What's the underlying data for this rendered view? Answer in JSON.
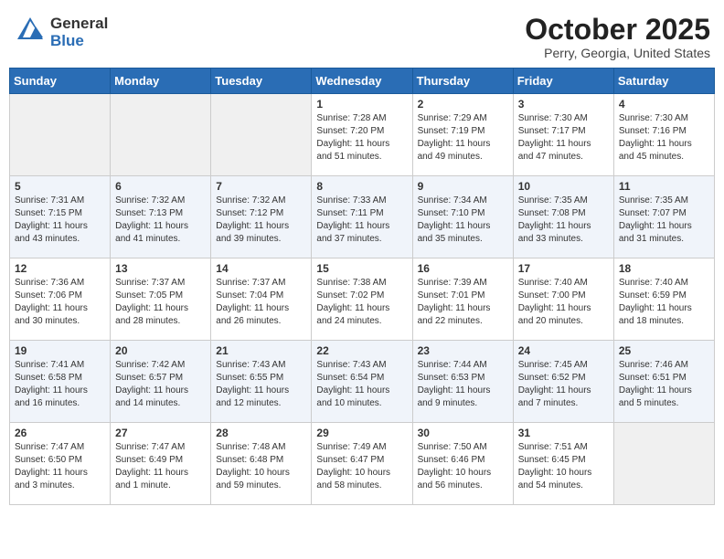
{
  "header": {
    "logo_general": "General",
    "logo_blue": "Blue",
    "month_title": "October 2025",
    "location": "Perry, Georgia, United States"
  },
  "days_of_week": [
    "Sunday",
    "Monday",
    "Tuesday",
    "Wednesday",
    "Thursday",
    "Friday",
    "Saturday"
  ],
  "weeks": [
    [
      {
        "num": "",
        "sunrise": "",
        "sunset": "",
        "daylight": "",
        "empty": true
      },
      {
        "num": "",
        "sunrise": "",
        "sunset": "",
        "daylight": "",
        "empty": true
      },
      {
        "num": "",
        "sunrise": "",
        "sunset": "",
        "daylight": "",
        "empty": true
      },
      {
        "num": "1",
        "sunrise": "Sunrise: 7:28 AM",
        "sunset": "Sunset: 7:20 PM",
        "daylight": "Daylight: 11 hours and 51 minutes.",
        "empty": false
      },
      {
        "num": "2",
        "sunrise": "Sunrise: 7:29 AM",
        "sunset": "Sunset: 7:19 PM",
        "daylight": "Daylight: 11 hours and 49 minutes.",
        "empty": false
      },
      {
        "num": "3",
        "sunrise": "Sunrise: 7:30 AM",
        "sunset": "Sunset: 7:17 PM",
        "daylight": "Daylight: 11 hours and 47 minutes.",
        "empty": false
      },
      {
        "num": "4",
        "sunrise": "Sunrise: 7:30 AM",
        "sunset": "Sunset: 7:16 PM",
        "daylight": "Daylight: 11 hours and 45 minutes.",
        "empty": false
      }
    ],
    [
      {
        "num": "5",
        "sunrise": "Sunrise: 7:31 AM",
        "sunset": "Sunset: 7:15 PM",
        "daylight": "Daylight: 11 hours and 43 minutes.",
        "empty": false
      },
      {
        "num": "6",
        "sunrise": "Sunrise: 7:32 AM",
        "sunset": "Sunset: 7:13 PM",
        "daylight": "Daylight: 11 hours and 41 minutes.",
        "empty": false
      },
      {
        "num": "7",
        "sunrise": "Sunrise: 7:32 AM",
        "sunset": "Sunset: 7:12 PM",
        "daylight": "Daylight: 11 hours and 39 minutes.",
        "empty": false
      },
      {
        "num": "8",
        "sunrise": "Sunrise: 7:33 AM",
        "sunset": "Sunset: 7:11 PM",
        "daylight": "Daylight: 11 hours and 37 minutes.",
        "empty": false
      },
      {
        "num": "9",
        "sunrise": "Sunrise: 7:34 AM",
        "sunset": "Sunset: 7:10 PM",
        "daylight": "Daylight: 11 hours and 35 minutes.",
        "empty": false
      },
      {
        "num": "10",
        "sunrise": "Sunrise: 7:35 AM",
        "sunset": "Sunset: 7:08 PM",
        "daylight": "Daylight: 11 hours and 33 minutes.",
        "empty": false
      },
      {
        "num": "11",
        "sunrise": "Sunrise: 7:35 AM",
        "sunset": "Sunset: 7:07 PM",
        "daylight": "Daylight: 11 hours and 31 minutes.",
        "empty": false
      }
    ],
    [
      {
        "num": "12",
        "sunrise": "Sunrise: 7:36 AM",
        "sunset": "Sunset: 7:06 PM",
        "daylight": "Daylight: 11 hours and 30 minutes.",
        "empty": false
      },
      {
        "num": "13",
        "sunrise": "Sunrise: 7:37 AM",
        "sunset": "Sunset: 7:05 PM",
        "daylight": "Daylight: 11 hours and 28 minutes.",
        "empty": false
      },
      {
        "num": "14",
        "sunrise": "Sunrise: 7:37 AM",
        "sunset": "Sunset: 7:04 PM",
        "daylight": "Daylight: 11 hours and 26 minutes.",
        "empty": false
      },
      {
        "num": "15",
        "sunrise": "Sunrise: 7:38 AM",
        "sunset": "Sunset: 7:02 PM",
        "daylight": "Daylight: 11 hours and 24 minutes.",
        "empty": false
      },
      {
        "num": "16",
        "sunrise": "Sunrise: 7:39 AM",
        "sunset": "Sunset: 7:01 PM",
        "daylight": "Daylight: 11 hours and 22 minutes.",
        "empty": false
      },
      {
        "num": "17",
        "sunrise": "Sunrise: 7:40 AM",
        "sunset": "Sunset: 7:00 PM",
        "daylight": "Daylight: 11 hours and 20 minutes.",
        "empty": false
      },
      {
        "num": "18",
        "sunrise": "Sunrise: 7:40 AM",
        "sunset": "Sunset: 6:59 PM",
        "daylight": "Daylight: 11 hours and 18 minutes.",
        "empty": false
      }
    ],
    [
      {
        "num": "19",
        "sunrise": "Sunrise: 7:41 AM",
        "sunset": "Sunset: 6:58 PM",
        "daylight": "Daylight: 11 hours and 16 minutes.",
        "empty": false
      },
      {
        "num": "20",
        "sunrise": "Sunrise: 7:42 AM",
        "sunset": "Sunset: 6:57 PM",
        "daylight": "Daylight: 11 hours and 14 minutes.",
        "empty": false
      },
      {
        "num": "21",
        "sunrise": "Sunrise: 7:43 AM",
        "sunset": "Sunset: 6:55 PM",
        "daylight": "Daylight: 11 hours and 12 minutes.",
        "empty": false
      },
      {
        "num": "22",
        "sunrise": "Sunrise: 7:43 AM",
        "sunset": "Sunset: 6:54 PM",
        "daylight": "Daylight: 11 hours and 10 minutes.",
        "empty": false
      },
      {
        "num": "23",
        "sunrise": "Sunrise: 7:44 AM",
        "sunset": "Sunset: 6:53 PM",
        "daylight": "Daylight: 11 hours and 9 minutes.",
        "empty": false
      },
      {
        "num": "24",
        "sunrise": "Sunrise: 7:45 AM",
        "sunset": "Sunset: 6:52 PM",
        "daylight": "Daylight: 11 hours and 7 minutes.",
        "empty": false
      },
      {
        "num": "25",
        "sunrise": "Sunrise: 7:46 AM",
        "sunset": "Sunset: 6:51 PM",
        "daylight": "Daylight: 11 hours and 5 minutes.",
        "empty": false
      }
    ],
    [
      {
        "num": "26",
        "sunrise": "Sunrise: 7:47 AM",
        "sunset": "Sunset: 6:50 PM",
        "daylight": "Daylight: 11 hours and 3 minutes.",
        "empty": false
      },
      {
        "num": "27",
        "sunrise": "Sunrise: 7:47 AM",
        "sunset": "Sunset: 6:49 PM",
        "daylight": "Daylight: 11 hours and 1 minute.",
        "empty": false
      },
      {
        "num": "28",
        "sunrise": "Sunrise: 7:48 AM",
        "sunset": "Sunset: 6:48 PM",
        "daylight": "Daylight: 10 hours and 59 minutes.",
        "empty": false
      },
      {
        "num": "29",
        "sunrise": "Sunrise: 7:49 AM",
        "sunset": "Sunset: 6:47 PM",
        "daylight": "Daylight: 10 hours and 58 minutes.",
        "empty": false
      },
      {
        "num": "30",
        "sunrise": "Sunrise: 7:50 AM",
        "sunset": "Sunset: 6:46 PM",
        "daylight": "Daylight: 10 hours and 56 minutes.",
        "empty": false
      },
      {
        "num": "31",
        "sunrise": "Sunrise: 7:51 AM",
        "sunset": "Sunset: 6:45 PM",
        "daylight": "Daylight: 10 hours and 54 minutes.",
        "empty": false
      },
      {
        "num": "",
        "sunrise": "",
        "sunset": "",
        "daylight": "",
        "empty": true
      }
    ]
  ]
}
